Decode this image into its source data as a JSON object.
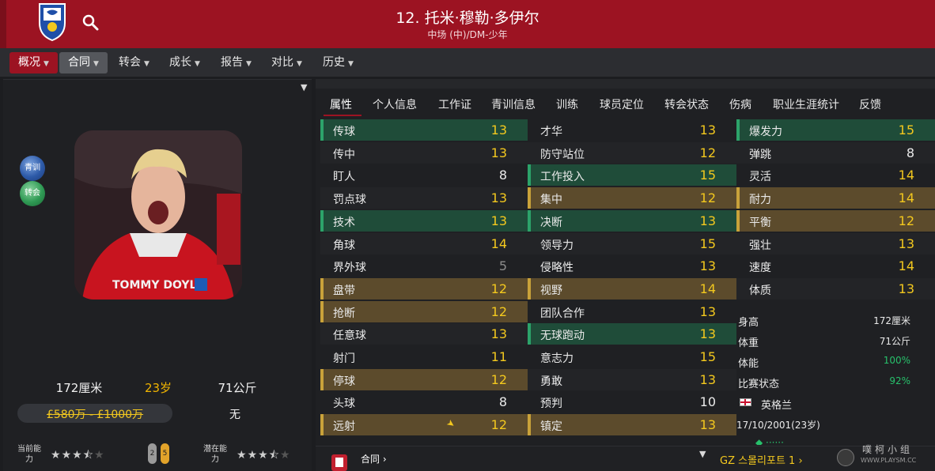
{
  "header": {
    "player_title": "12. 托米·穆勒·多伊尔",
    "player_position": "中场 (中)/DM-少年"
  },
  "nav": [
    {
      "label": "概况",
      "state": "active"
    },
    {
      "label": "合同",
      "state": "hover"
    },
    {
      "label": "转会",
      "state": "normal"
    },
    {
      "label": "成长",
      "state": "normal"
    },
    {
      "label": "报告",
      "state": "normal"
    },
    {
      "label": "对比",
      "state": "normal"
    },
    {
      "label": "历史",
      "state": "normal"
    }
  ],
  "left": {
    "youth_button": "青训",
    "transfer_button": "转会",
    "photo_caption": "TOMMY DOYLE",
    "height": "172厘米",
    "age": "23岁",
    "weight": "71公斤",
    "value": "£580万 - £1000万",
    "release_clause": "无",
    "current_ability_label": "当前能力",
    "current_ability_stars": 3.5,
    "potential_ability_label": "潜在能力",
    "potential_ability_stars": 3.5,
    "pip1": "2",
    "pip2": "5"
  },
  "tabs": [
    "属性",
    "个人信息",
    "工作证",
    "青训信息",
    "训练",
    "球员定位",
    "转会状态",
    "伤病",
    "职业生涯统计",
    "反馈"
  ],
  "attributes": {
    "technical": [
      {
        "label": "传球",
        "value": "13",
        "hl": "green",
        "color": "yellow"
      },
      {
        "label": "传中",
        "value": "13",
        "hl": "plain",
        "color": "yellow"
      },
      {
        "label": "盯人",
        "value": "8",
        "hl": "plain",
        "color": "white"
      },
      {
        "label": "罚点球",
        "value": "13",
        "hl": "plain",
        "color": "yellow"
      },
      {
        "label": "技术",
        "value": "13",
        "hl": "green",
        "color": "yellow"
      },
      {
        "label": "角球",
        "value": "14",
        "hl": "plain",
        "color": "yellow"
      },
      {
        "label": "界外球",
        "value": "5",
        "hl": "plain",
        "color": "grey"
      },
      {
        "label": "盘带",
        "value": "12",
        "hl": "gold",
        "color": "yellow"
      },
      {
        "label": "抢断",
        "value": "12",
        "hl": "gold",
        "color": "yellow"
      },
      {
        "label": "任意球",
        "value": "13",
        "hl": "plain",
        "color": "yellow"
      },
      {
        "label": "射门",
        "value": "11",
        "hl": "plain",
        "color": "yellow"
      },
      {
        "label": "停球",
        "value": "12",
        "hl": "gold",
        "color": "yellow"
      },
      {
        "label": "头球",
        "value": "8",
        "hl": "plain",
        "color": "white"
      },
      {
        "label": "远射",
        "value": "12",
        "hl": "gold",
        "color": "yellow",
        "arrow": true
      }
    ],
    "mental": [
      {
        "label": "才华",
        "value": "13",
        "hl": "plain",
        "color": "yellow"
      },
      {
        "label": "防守站位",
        "value": "12",
        "hl": "plain",
        "color": "yellow"
      },
      {
        "label": "工作投入",
        "value": "15",
        "hl": "green",
        "color": "yellow"
      },
      {
        "label": "集中",
        "value": "12",
        "hl": "gold",
        "color": "yellow"
      },
      {
        "label": "决断",
        "value": "13",
        "hl": "green",
        "color": "yellow"
      },
      {
        "label": "领导力",
        "value": "15",
        "hl": "plain",
        "color": "yellow"
      },
      {
        "label": "侵略性",
        "value": "13",
        "hl": "plain",
        "color": "yellow"
      },
      {
        "label": "视野",
        "value": "14",
        "hl": "gold",
        "color": "yellow"
      },
      {
        "label": "团队合作",
        "value": "13",
        "hl": "plain",
        "color": "yellow"
      },
      {
        "label": "无球跑动",
        "value": "13",
        "hl": "green",
        "color": "yellow"
      },
      {
        "label": "意志力",
        "value": "15",
        "hl": "plain",
        "color": "yellow"
      },
      {
        "label": "勇敢",
        "value": "13",
        "hl": "plain",
        "color": "yellow"
      },
      {
        "label": "预判",
        "value": "10",
        "hl": "plain",
        "color": "white"
      },
      {
        "label": "镇定",
        "value": "13",
        "hl": "gold",
        "color": "yellow"
      }
    ],
    "physical": [
      {
        "label": "爆发力",
        "value": "15",
        "hl": "green",
        "color": "yellow"
      },
      {
        "label": "弹跳",
        "value": "8",
        "hl": "plain",
        "color": "white"
      },
      {
        "label": "灵活",
        "value": "14",
        "hl": "plain",
        "color": "yellow"
      },
      {
        "label": "耐力",
        "value": "14",
        "hl": "gold",
        "color": "yellow"
      },
      {
        "label": "平衡",
        "value": "12",
        "hl": "gold",
        "color": "yellow"
      },
      {
        "label": "强壮",
        "value": "13",
        "hl": "plain",
        "color": "yellow"
      },
      {
        "label": "速度",
        "value": "14",
        "hl": "plain",
        "color": "yellow"
      },
      {
        "label": "体质",
        "value": "13",
        "hl": "plain",
        "color": "yellow"
      }
    ]
  },
  "info": [
    {
      "label": "身高",
      "value": "172厘米",
      "color": "white"
    },
    {
      "label": "体重",
      "value": "71公斤",
      "color": "white"
    },
    {
      "label": "体能",
      "value": "100%",
      "color": "green"
    },
    {
      "label": "比赛状态",
      "value": "92%",
      "color": "green"
    }
  ],
  "nationality": "英格兰",
  "dob": "17/10/2001(23岁)",
  "bottom": {
    "contract_label": "合同",
    "club_label": "GZ 스몰리포트 1"
  },
  "watermark": {
    "line1": "噗柯小组",
    "line2": "WWW.PLAYSM.CC"
  }
}
